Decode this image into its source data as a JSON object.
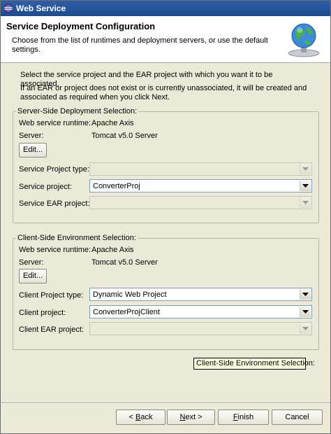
{
  "window": {
    "title": "Web Service"
  },
  "header": {
    "title": "Service Deployment Configuration",
    "description": "Choose from the list of runtimes and deployment servers, or use the default settings."
  },
  "intro": {
    "line1": "Select the service project and the EAR project with which you want it to be associated.",
    "line2": "If an EAR or project does not exist or is currently unassociated, it will be created and associated as required when you click Next."
  },
  "server_group": {
    "legend": "Server-Side Deployment Selection:",
    "runtime_label": "Web service runtime:",
    "runtime_value": "Apache Axis",
    "server_label": "Server:",
    "server_value": "Tomcat v5.0 Server",
    "edit_label": "Edit...",
    "project_type_label": "Service Project type:",
    "project_type_value": "",
    "project_label": "Service project:",
    "project_value": "ConverterProj",
    "ear_label": "Service EAR project:",
    "ear_value": ""
  },
  "client_group": {
    "legend": "Client-Side Environment Selection:",
    "runtime_label": "Web service runtime:",
    "runtime_value": "Apache Axis",
    "server_label": "Server:",
    "server_value": "Tomcat v5.0 Server",
    "edit_label": "Edit...",
    "project_type_label": "Client Project type:",
    "project_type_value": "Dynamic Web Project",
    "project_label": "Client project:",
    "project_value": "ConverterProjClient",
    "ear_label": "Client EAR project:",
    "ear_value": ""
  },
  "tooltip": {
    "text": "Client-Side Environment Selection:"
  },
  "buttons": {
    "back_prefix": "< ",
    "back_mnemonic": "B",
    "back_rest": "ack",
    "next_mnemonic": "N",
    "next_rest": "ext >",
    "finish_mnemonic": "F",
    "finish_rest": "inish",
    "cancel": "Cancel"
  }
}
